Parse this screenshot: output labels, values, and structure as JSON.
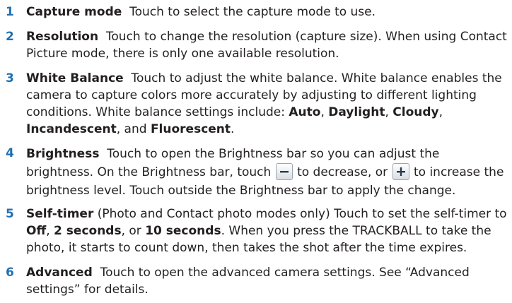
{
  "colors": {
    "number": "#1f6fb2",
    "text": "#231f20",
    "icon_border": "#9aa6b2"
  },
  "items": [
    {
      "number": "1",
      "term": "Capture mode",
      "text": "Touch to select the capture mode to use."
    },
    {
      "number": "2",
      "term": "Resolution",
      "text": "Touch to change the resolution (capture size). When using Contact Picture mode, there is only one available resolution."
    },
    {
      "number": "3",
      "term": "White Balance",
      "text": "Touch to adjust the white balance. White balance enables the camera to capture colors more accurately by adjusting to different lighting conditions. White balance settings include: ",
      "opt1": "Auto",
      "sep1": ", ",
      "opt2": "Daylight",
      "sep2": ", ",
      "opt3": "Cloudy",
      "sep3": ", ",
      "opt4": "Incandescent",
      "sep4": ", and ",
      "opt5": "Fluorescent",
      "end": "."
    },
    {
      "number": "4",
      "term": "Brightness",
      "text1": "Touch to open the Brightness bar so you can adjust the brightness. On the Brightness bar, touch ",
      "decrease_icon": "minus-icon",
      "text2": " to decrease, or ",
      "increase_icon": "plus-icon",
      "text3": " to increase the brightness level. Touch outside the Brightness bar to apply the change."
    },
    {
      "number": "5",
      "term": "Self-timer",
      "text1": " (Photo and Contact photo modes only)  Touch to set the self-timer to ",
      "opt1": "Off",
      "sep1": ", ",
      "opt2": "2 seconds",
      "sep2": ", or ",
      "opt3": "10 seconds",
      "text2": ". When you press the TRACKBALL to take the photo, it starts to count down, then takes the shot after the time expires."
    },
    {
      "number": "6",
      "term": "Advanced",
      "text": "Touch to open the advanced camera settings. See “Advanced settings” for details."
    }
  ]
}
